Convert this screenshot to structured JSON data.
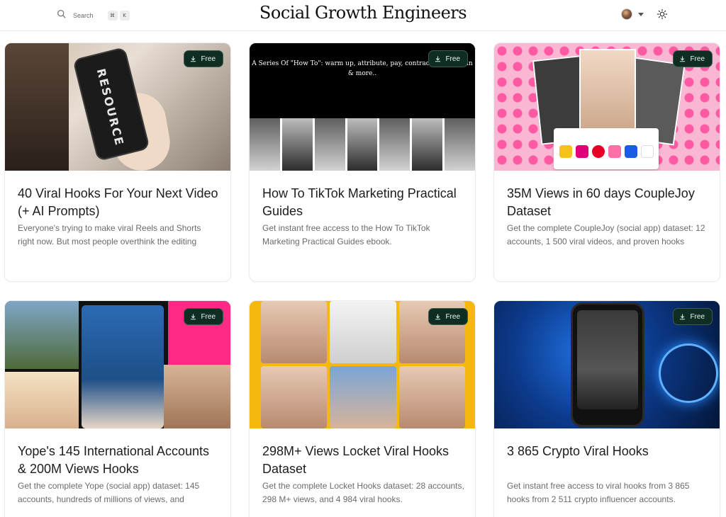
{
  "header": {
    "search_label": "Search",
    "shortcut_keys": [
      "⌘",
      "K"
    ],
    "brand": "Social Growth Engineers",
    "icons": {
      "search": "search-icon",
      "caret": "chevron-down-icon",
      "theme": "sun-icon"
    }
  },
  "cards": [
    {
      "badge": "Free",
      "title": "40 Viral Hooks For Your Next Video (+ AI Prompts)",
      "description": "Everyone's trying to make viral Reels and Shorts right now. But most people overthink the editing"
    },
    {
      "badge": "Free",
      "title": "How To TikTok Marketing Practical Guides",
      "description": "Get instant free access to the How To TikTok Marketing Practical Guides ebook.",
      "image_text": "A Series Of \"How To\": warm up, attribute, pay, contract, shadowban & more.."
    },
    {
      "badge": "Free",
      "title": "35M Views in 60 days CoupleJoy Dataset",
      "description": "Get the complete CoupleJoy (social app) dataset: 12 accounts, 1 500 viral videos, and proven hooks"
    },
    {
      "badge": "Free",
      "title": "Yope's 145 International Accounts & 200M Views Hooks",
      "description": "Get the complete Yope (social app) dataset: 145 accounts, hundreds of millions of views, and"
    },
    {
      "badge": "Free",
      "title": "298M+ Views Locket Viral Hooks Dataset",
      "description": "Get the complete Locket Hooks dataset: 28 accounts, 298 M+ views, and 4 984 viral hooks."
    },
    {
      "badge": "Free",
      "title": "3 865 Crypto Viral Hooks",
      "description": "Get instant free access to viral hooks from 3 865 hooks from 2 511 crypto influencer accounts."
    }
  ]
}
